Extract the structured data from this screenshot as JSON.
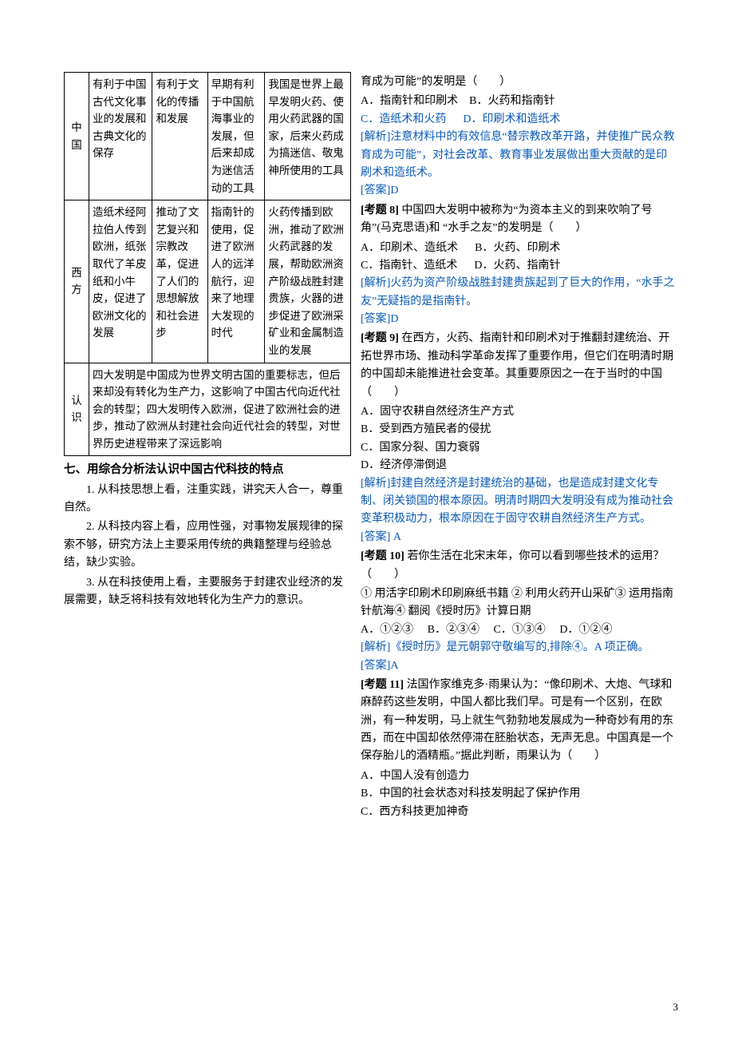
{
  "table": {
    "rows": [
      {
        "side": "中国",
        "c1": "有利于中国古代文化事业的发展和古典文化的保存",
        "c2": "有利于文化的传播和发展",
        "c3": "早期有利于中国航海事业的发展，但后来却成为迷信活动的工具",
        "c4": "我国是世界上最早发明火药、使用火药武器的国家，后来火药成为搞迷信、敬鬼神所使用的工具"
      },
      {
        "side": "西方",
        "c1": "造纸术经阿拉伯人传到欧洲，纸张取代了羊皮纸和小牛皮，促进了欧洲文化的发展",
        "c2": "推动了文艺复兴和宗教改革，促进了人们的思想解放和社会进步",
        "c3": "指南针的使用，促进了欧洲人的远洋航行，迎来了地理大发现的时代",
        "c4": "火药传播到欧洲，推动了欧洲火药武器的发展，帮助欧洲资产阶级战胜封建贵族，火器的进步促进了欧洲采矿业和金属制造业的发展"
      }
    ],
    "recognition": {
      "label": "认识",
      "text": "四大发明是中国成为世界文明古国的重要标志，但后来却没有转化为生产力，这影响了中国古代向近代社会的转型；四大发明传入欧洲，促进了欧洲社会的进步，推动了欧洲从封建社会向近代社会的转型，对世界历史进程带来了深远影响"
    }
  },
  "section7": {
    "title": "七、用综合分析法认识中国古代科技的特点",
    "p1": "1. 从科技思想上看，注重实践，讲究天人合一，尊重自然。",
    "p2": "2. 从科技内容上看，应用性强，对事物发展规律的探索不够，研究方法上主要采用传统的典籍整理与经验总结，缺少实验。",
    "p3": "3. 从在科技使用上看，主要服务于封建农业经济的发展需要，缺乏将科技有效地转化为生产力的意识。"
  },
  "right_top": "育成为可能”的发明是（　　）",
  "q7": {
    "optA": "A．指南针和印刷术",
    "optB": "B．火药和指南针",
    "optC": "C．造纸术和火药",
    "optD": "D．印刷术和造纸术",
    "analysis_label": "[解析]",
    "analysis": "注意材料中的有效信息“替宗教改革开路，并使推广民众教育成为可能”，对社会改革、教育事业发展做出重大贡献的是印刷术和造纸术。",
    "answer_label": "[答案]",
    "answer": "D"
  },
  "q8": {
    "title": "[考题 8]",
    "stem": "中国四大发明中被称为“为资本主义的到来吹响了号角”(马克思语)和 “水手之友”的发明是（　　）",
    "optA": "A．印刷术、造纸术",
    "optB": "B．火药、印刷术",
    "optC": "C．指南针、造纸术",
    "optD": "D．火药、指南针",
    "analysis_label": "[解析]",
    "analysis": "火药为资产阶级战胜封建贵族起到了巨大的作用，“水手之友”无疑指的是指南针。",
    "answer_label": "[答案]",
    "answer": "D"
  },
  "q9": {
    "title": "[考题 9]",
    "stem": "在西方，火药、指南针和印刷术对于推翻封建统治、开拓世界市场、推动科学革命发挥了重要作用，但它们在明清时期的中国却未能推进社会变革。其重要原因之一在于当时的中国（　　）",
    "optA": "A．固守农耕自然经济生产方式",
    "optB": "B．受到西方殖民者的侵扰",
    "optC": "C．国家分裂、国力衰弱",
    "optD": "D．经济停滞倒退",
    "analysis_label": "[解析]",
    "analysis": "封建自然经济是封建统治的基础，也是造成封建文化专制、闭关锁国的根本原因。明清时期四大发明没有成为推动社会变革积极动力，根本原因在于固守农耕自然经济生产方式。",
    "answer_label": "[答案]",
    "answer": " A"
  },
  "q10": {
    "title": "[考题 10]",
    "stem": "若你生活在北宋末年，你可以看到哪些技术的运用？（　　）",
    "items": "① 用活字印刷术印刷麻纸书籍  ② 利用火药开山采矿③ 运用指南针航海④  翻阅《授时历》计算日期",
    "optA": "A．①②③",
    "optB": "B．②③④",
    "optC": "C．①③④",
    "optD": "D．①②④",
    "analysis_label": "[解析]",
    "analysis": "《授时历》是元朝郭守敬编写的,排除④。A 项正确。",
    "answer_label": "[答案]",
    "answer": "A"
  },
  "q11": {
    "title": "[考题 11]",
    "stem": "法国作家维克多·雨果认为：“像印刷术、大炮、气球和麻醉药这些发明，中国人都比我们早。可是有一个区别，在欧洲，有一种发明，马上就生气勃勃地发展成为一种奇妙有用的东西，而在中国却依然停滞在胚胎状态，无声无息。中国真是一个保存胎儿的酒精瓶。”据此判断，雨果认为（　　）",
    "optA": "A．中国人没有创造力",
    "optB": "B．中国的社会状态对科技发明起了保护作用",
    "optC": "C．西方科技更加神奇"
  },
  "pagenum": "3"
}
